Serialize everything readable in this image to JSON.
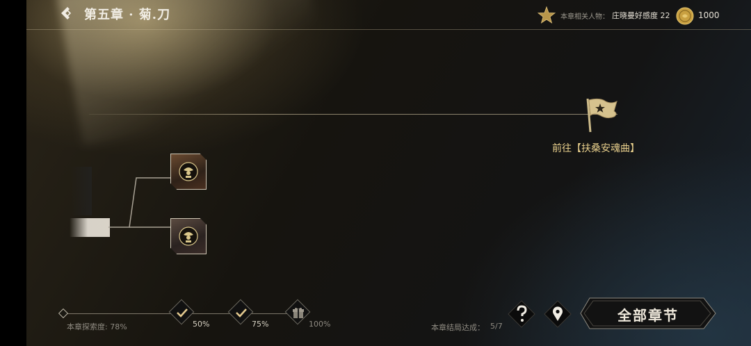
{
  "header": {
    "chapter_title": "第五章 · 菊.刀",
    "favor_label": "本章相关人物：",
    "favor_value": "庄晓曼好感度 22",
    "coins": "1000"
  },
  "route": {
    "goal_label": "前往【扶桑安魂曲】"
  },
  "progress": {
    "label": "本章探索度: 78%",
    "value_percent": 78,
    "milestones": [
      {
        "label": "50%",
        "state": "claimed",
        "icon": "check-icon"
      },
      {
        "label": "75%",
        "state": "claimed",
        "icon": "check-icon"
      },
      {
        "label": "100%",
        "state": "locked",
        "icon": "gift-icon"
      }
    ]
  },
  "ending": {
    "label": "本章结局达成：",
    "value": "5/7"
  },
  "buttons": {
    "all_chapters": "全部章节",
    "help_icon": "question-icon",
    "map_icon": "location-pin-icon"
  },
  "colors": {
    "accent_gold": "#e8cf8c",
    "coin_gold": "#c9a041"
  }
}
